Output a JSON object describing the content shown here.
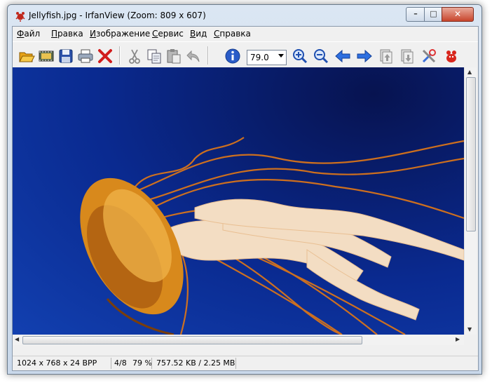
{
  "window": {
    "title": "Jellyfish.jpg - IrfanView (Zoom: 809 x 607)",
    "controls": {
      "minimize": "–",
      "maximize": "□",
      "close": "✕"
    }
  },
  "menu": {
    "items": [
      {
        "label": "Файл",
        "accel": "Ф",
        "rest": "айл"
      },
      {
        "label": "Правка",
        "accel": "П",
        "rest": "равка"
      },
      {
        "label": "Изображение",
        "accel": "И",
        "rest": "зображение"
      },
      {
        "label": "Сервис",
        "accel": "С",
        "rest": "ервис"
      },
      {
        "label": "Вид",
        "accel": "В",
        "rest": "ид"
      },
      {
        "label": "Справка",
        "accel": "С",
        "rest": "правка"
      }
    ]
  },
  "toolbar": {
    "icons": [
      "open-folder-icon",
      "slideshow-icon",
      "save-icon",
      "print-icon",
      "delete-icon",
      "cut-icon",
      "copy-icon",
      "paste-icon",
      "undo-icon",
      "info-icon",
      "zoom-in-icon",
      "zoom-out-icon",
      "previous-icon",
      "next-icon",
      "page-up-icon",
      "page-down-icon",
      "settings-icon",
      "irfanview-logo-icon"
    ],
    "zoom_value": "79.0"
  },
  "image": {
    "subject": "jellyfish"
  },
  "status": {
    "dimensions": "1024 x 768 x 24 BPP",
    "index": "4/8",
    "zoom": "79 %",
    "size": "757.52 KB / 2.25 MB"
  },
  "colors": {
    "water_dark": "#071350",
    "water_light": "#1240b0",
    "jelly_orange": "#d8891c",
    "close_red": "#c8452c"
  }
}
